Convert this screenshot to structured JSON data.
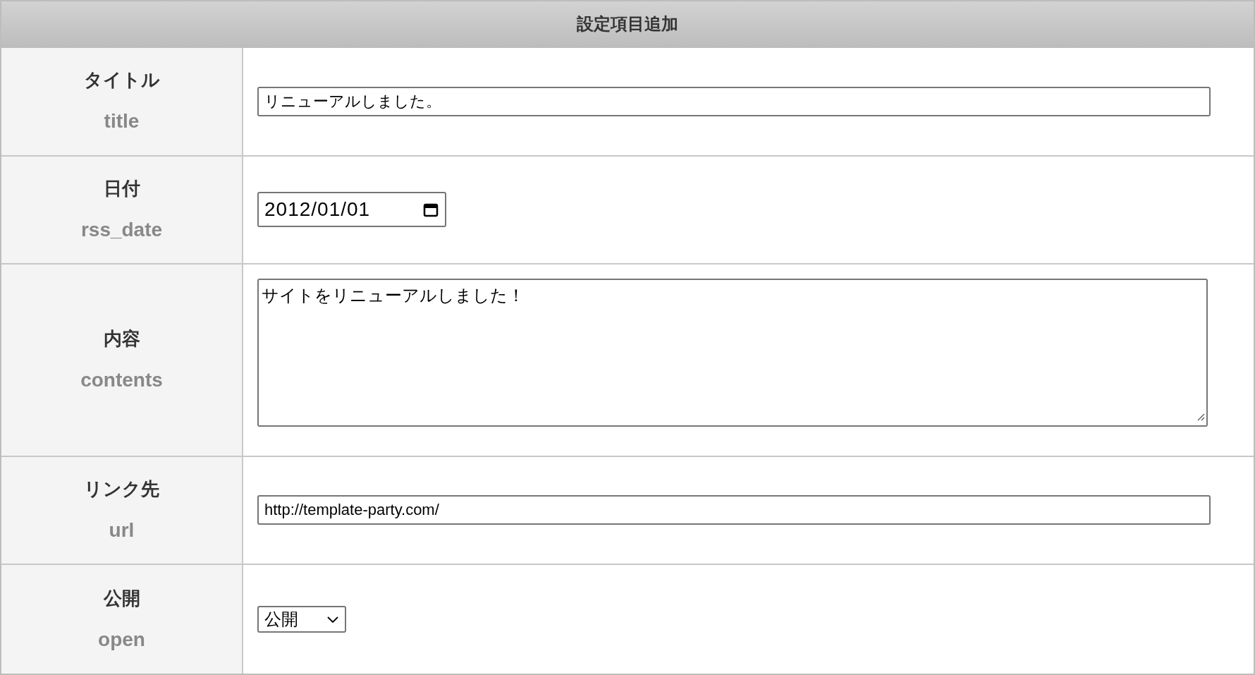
{
  "header": {
    "title": "設定項目追加"
  },
  "rows": [
    {
      "label": "タイトル",
      "key": "title",
      "kind": "text",
      "value": "リニューアルしました。"
    },
    {
      "label": "日付",
      "key": "rss_date",
      "kind": "date",
      "value": "2012/01/01"
    },
    {
      "label": "内容",
      "key": "contents",
      "kind": "textarea",
      "value": "サイトをリニューアルしました！"
    },
    {
      "label": "リンク先",
      "key": "url",
      "kind": "text",
      "value": "http://template-party.com/"
    },
    {
      "label": "公開",
      "key": "open",
      "kind": "select",
      "value": "公開"
    }
  ]
}
